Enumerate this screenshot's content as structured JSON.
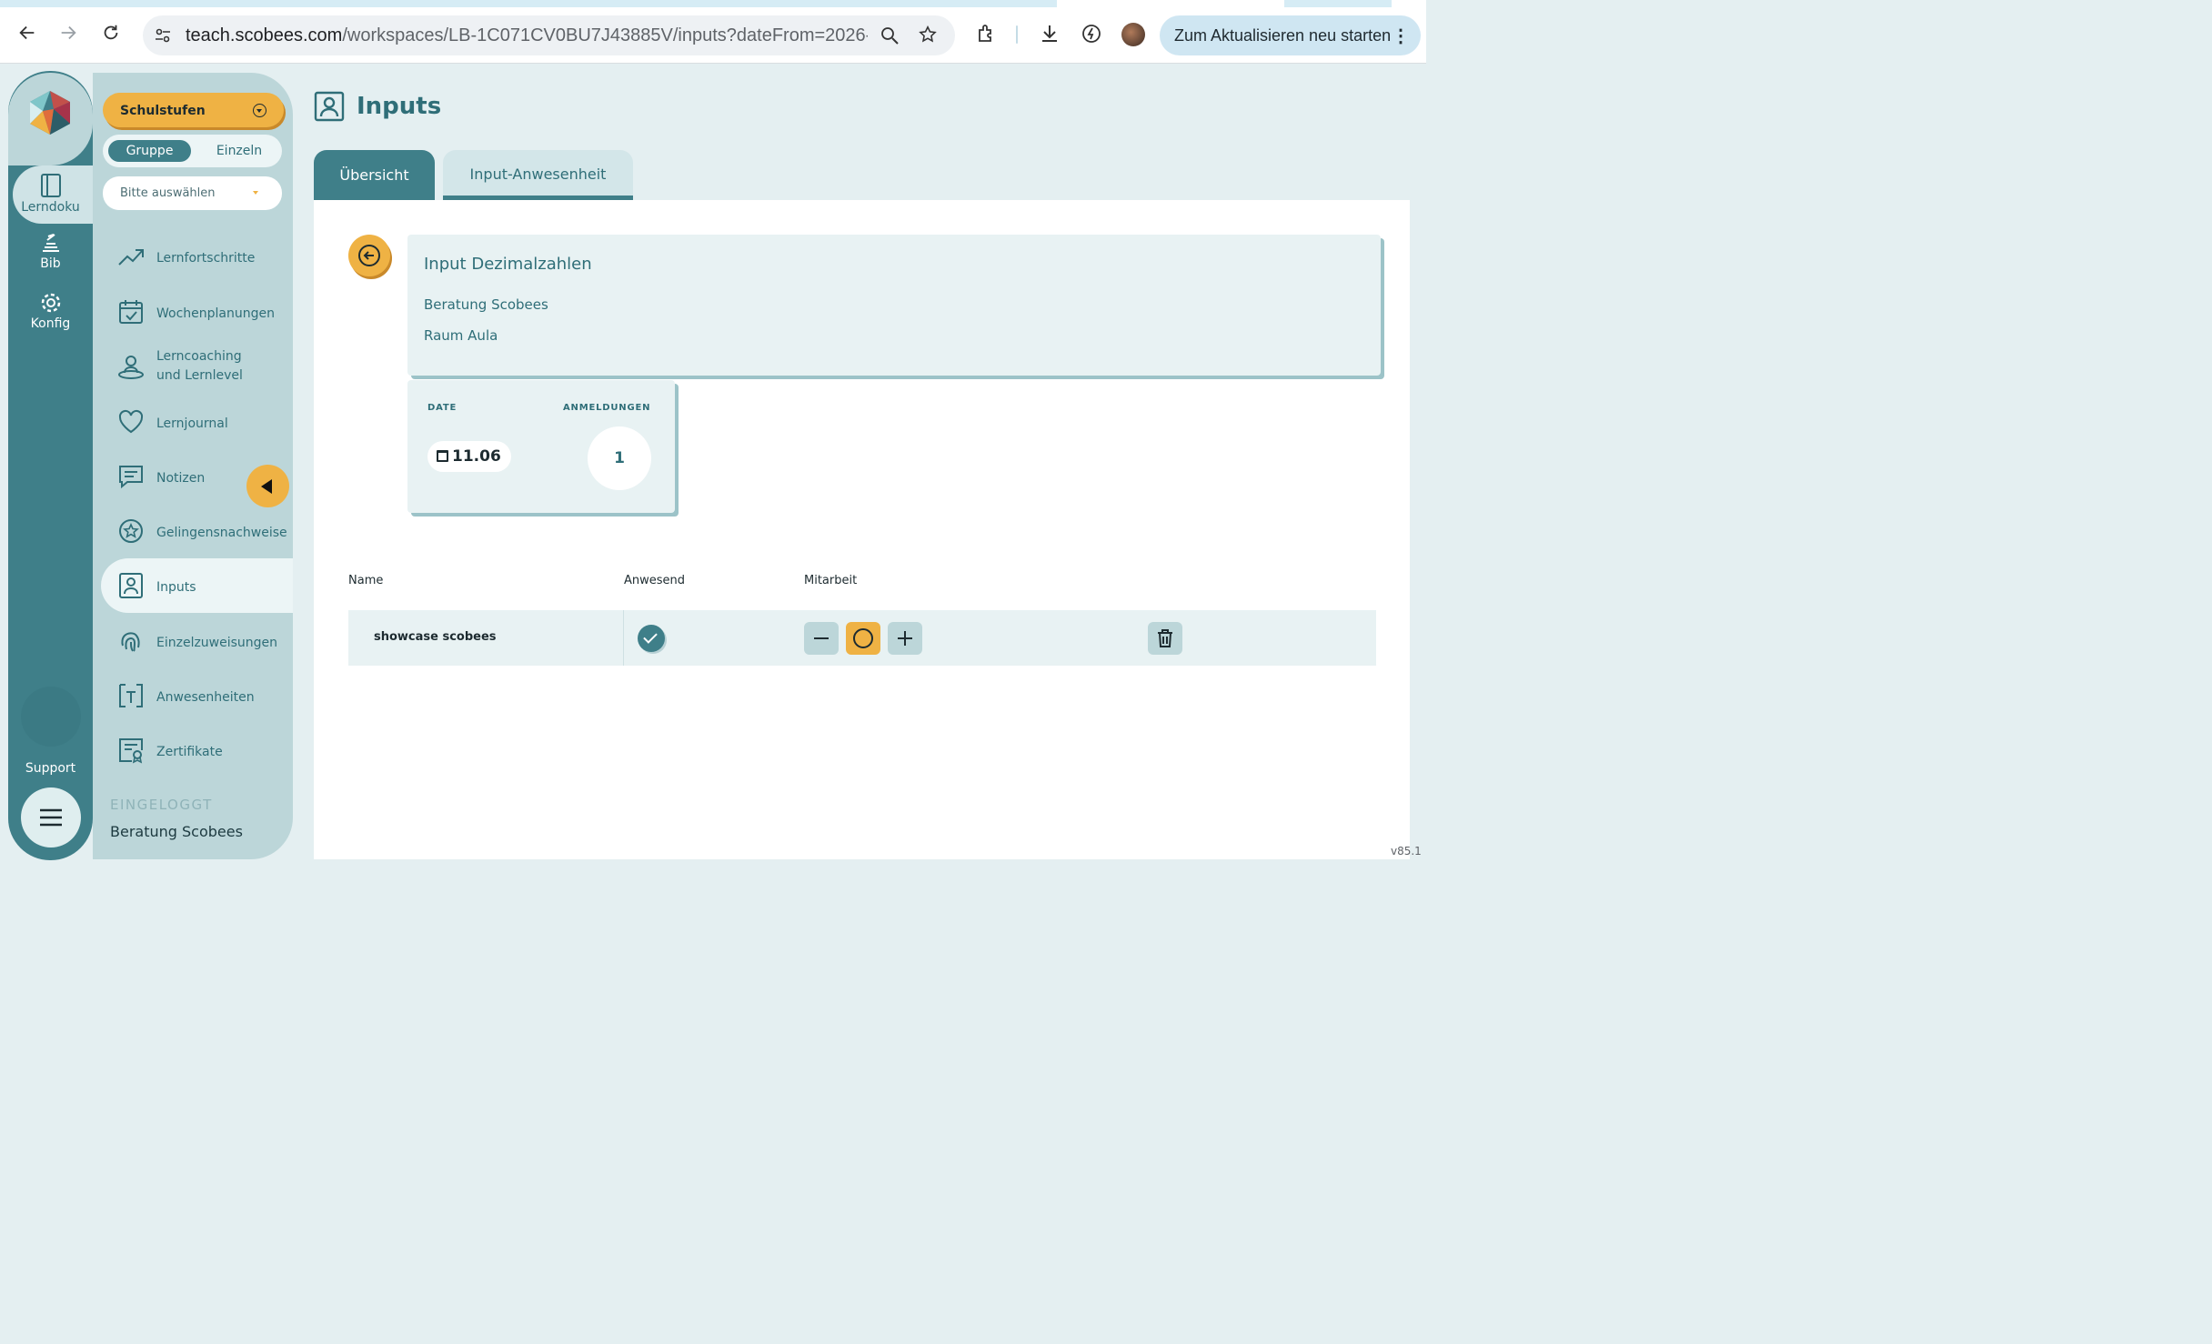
{
  "browser": {
    "url_domain": "teach.scobees.com",
    "url_path": "/workspaces/LB-1C071CV0BU7J43885V/inputs?dateFrom=2026-...",
    "update_button": "Zum Aktualisieren neu starten"
  },
  "rail": {
    "items": [
      {
        "label": "Lerndoku",
        "icon": "notebook-icon"
      },
      {
        "label": "Bib",
        "icon": "library-icon"
      },
      {
        "label": "Konfig",
        "icon": "gear-icon"
      }
    ],
    "support_label": "Support"
  },
  "sidebar": {
    "schulstufen_label": "Schulstufen",
    "toggle": {
      "group": "Gruppe",
      "single": "Einzeln"
    },
    "select_placeholder": "Bitte auswählen",
    "items": [
      {
        "label": "Lernfortschritte",
        "icon": "trend-icon"
      },
      {
        "label": "Wochenplanungen",
        "icon": "calendar-check-icon"
      },
      {
        "label": "Lerncoaching\nund Lernlevel",
        "icon": "person-target-icon"
      },
      {
        "label": "Lernjournal",
        "icon": "heart-icon"
      },
      {
        "label": "Notizen",
        "icon": "message-icon"
      },
      {
        "label": "Gelingensnachweise",
        "icon": "star-badge-icon"
      },
      {
        "label": "Inputs",
        "icon": "person-card-icon"
      },
      {
        "label": "Einzelzuweisungen",
        "icon": "fingerprint-icon"
      },
      {
        "label": "Anwesenheiten",
        "icon": "attendance-icon"
      },
      {
        "label": "Zertifikate",
        "icon": "certificate-icon"
      }
    ],
    "active_item": "Inputs",
    "logged_in_label": "EINGELOGGT",
    "logged_in_user": "Beratung Scobees"
  },
  "main": {
    "title": "Inputs",
    "tabs": [
      {
        "label": "Übersicht",
        "active": true
      },
      {
        "label": "Input-Anwesenheit",
        "active": false
      }
    ],
    "input": {
      "title": "Input Dezimalzahlen",
      "teacher": "Beratung Scobees",
      "room": "Raum Aula"
    },
    "stats": {
      "date_label": "DATE",
      "date_value": "11.06",
      "signups_label": "ANMELDUNGEN",
      "signups_value": "1"
    },
    "table": {
      "headers": [
        "Name",
        "Anwesend",
        "Mitarbeit"
      ],
      "rows": [
        {
          "name": "showcase scobees",
          "present": true
        }
      ]
    }
  },
  "version": "v85.1",
  "colors": {
    "primary": "#3f7f89",
    "accent": "#efb244",
    "panel": "#bcd6d9",
    "background": "#e4eff1"
  }
}
